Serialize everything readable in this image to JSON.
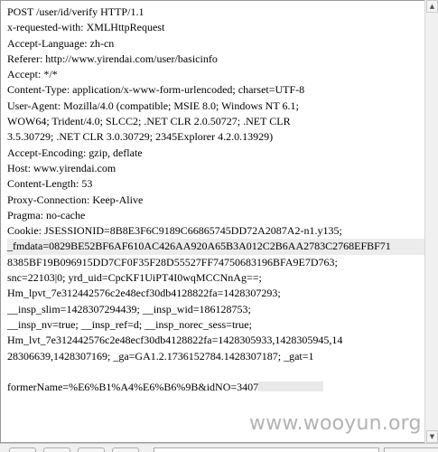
{
  "request": {
    "lines": [
      "POST /user/id/verify HTTP/1.1",
      "x-requested-with: XMLHttpRequest",
      "Accept-Language: zh-cn",
      "Referer: http://www.yirendai.com/user/basicinfo",
      "Accept: */*",
      "Content-Type: application/x-www-form-urlencoded; charset=UTF-8",
      "User-Agent: Mozilla/4.0 (compatible; MSIE 8.0; Windows NT 6.1;",
      "WOW64; Trident/4.0; SLCC2; .NET CLR 2.0.50727; .NET CLR",
      "3.5.30729; .NET CLR 3.0.30729; 2345Explorer 4.2.0.13929)",
      "Accept-Encoding: gzip, deflate",
      "Host: www.yirendai.com",
      "Content-Length: 53",
      "Proxy-Connection: Keep-Alive",
      "Pragma: no-cache",
      "Cookie: JSESSIONID=8B8E3F6C9189C66865745DD72A2087A2-n1.y135;",
      "_fmdata=0829BE52BF6AF610AC426AA920A65B3A012C2B6AA2783C2768EFBF71",
      "8385BF19B096915DD7CF0F35F28D55527FF74750683196BFA9E7D763;",
      "snc=22103|0; yrd_uid=CpcKF1UiPT4I0wqMCCNnAg==;",
      "Hm_lpvt_7e312442576c2e48ecf30db4128822fa=1428307293;",
      "__insp_slim=1428307294439; __insp_wid=186128753;",
      "__insp_nv=true; __insp_ref=d; __insp_norec_sess=true;",
      "Hm_lvt_7e312442576c2e48ecf30db4128822fa=1428305933,1428305945,14",
      "28306639,1428307169; _ga=GA1.2.1736152784.1428307187; _gat=1",
      "",
      "formerName=%E6%B1%A4%E6%B6%9B&idNO=3407"
    ]
  },
  "watermark": "www.wooyun.org",
  "icons": {
    "scroll_up": "scroll-up-arrow",
    "scroll_down": "scroll-down-arrow"
  }
}
